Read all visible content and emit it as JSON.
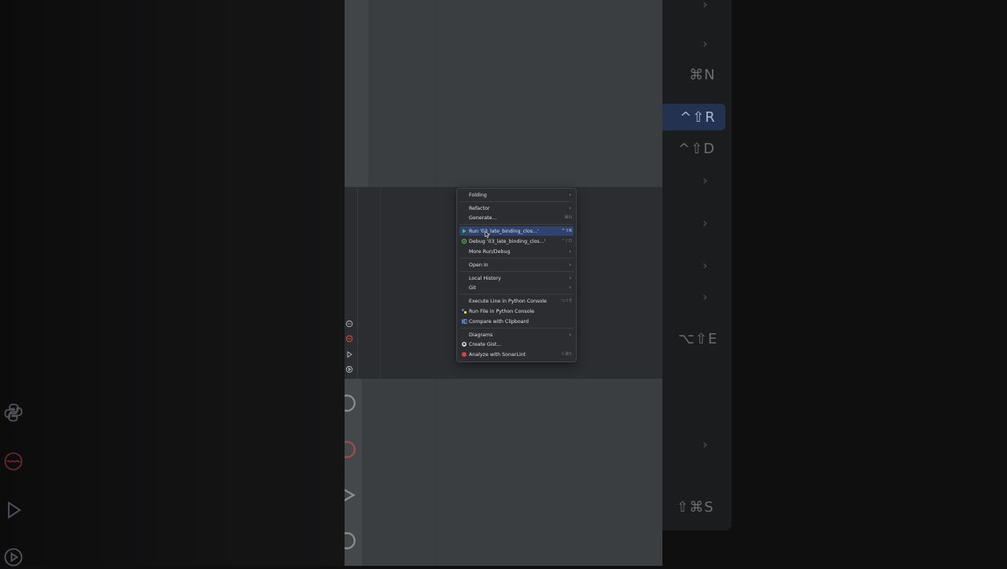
{
  "colors": {
    "accent": "#2e436e",
    "menu_bg": "#2b2d30",
    "frame_bg": "#3b3e41"
  },
  "background_left_icons": [
    "python-icon",
    "sonarlint-icon",
    "run-icon",
    "debug-icon"
  ],
  "background_right": {
    "shortcuts": [
      "⌘N",
      "^⇧R",
      "^⇧D",
      "⌥⇧E",
      "⇧⌘S"
    ]
  },
  "gutter_icons": [
    "python-console-icon",
    "sonarlint-icon",
    "run-icon",
    "debug-icon"
  ],
  "context_menu": {
    "items": [
      {
        "label": "Folding",
        "shortcut": "",
        "submenu": true,
        "icon": ""
      },
      {
        "label": "Refactor",
        "shortcut": "",
        "submenu": true,
        "icon": ""
      },
      {
        "label": "Generate...",
        "shortcut": "⌘N",
        "submenu": false,
        "icon": ""
      },
      {
        "label": "Run '03_late_binding_clos...'",
        "shortcut": "^⇧R",
        "submenu": false,
        "icon": "run-icon",
        "selected": true
      },
      {
        "label": "Debug '03_late_binding_clos...'",
        "shortcut": "^⇧D",
        "submenu": false,
        "icon": "debug-icon"
      },
      {
        "label": "More Run/Debug",
        "shortcut": "",
        "submenu": true,
        "icon": ""
      },
      {
        "label": "Open In",
        "shortcut": "",
        "submenu": true,
        "icon": ""
      },
      {
        "label": "Local History",
        "shortcut": "",
        "submenu": true,
        "icon": ""
      },
      {
        "label": "Git",
        "shortcut": "",
        "submenu": true,
        "icon": ""
      },
      {
        "label": "Execute Line in Python Console",
        "shortcut": "⌥⇧E",
        "submenu": false,
        "icon": ""
      },
      {
        "label": "Run File in Python Console",
        "shortcut": "",
        "submenu": false,
        "icon": "python-console-icon"
      },
      {
        "label": "Compare with Clipboard",
        "shortcut": "",
        "submenu": false,
        "icon": "compare-icon"
      },
      {
        "label": "Diagrams",
        "shortcut": "",
        "submenu": true,
        "icon": ""
      },
      {
        "label": "Create Gist...",
        "shortcut": "",
        "submenu": false,
        "icon": "github-icon"
      },
      {
        "label": "Analyze with SonarLint",
        "shortcut": "⇧⌘S",
        "submenu": false,
        "icon": "sonarlint-icon"
      }
    ]
  }
}
